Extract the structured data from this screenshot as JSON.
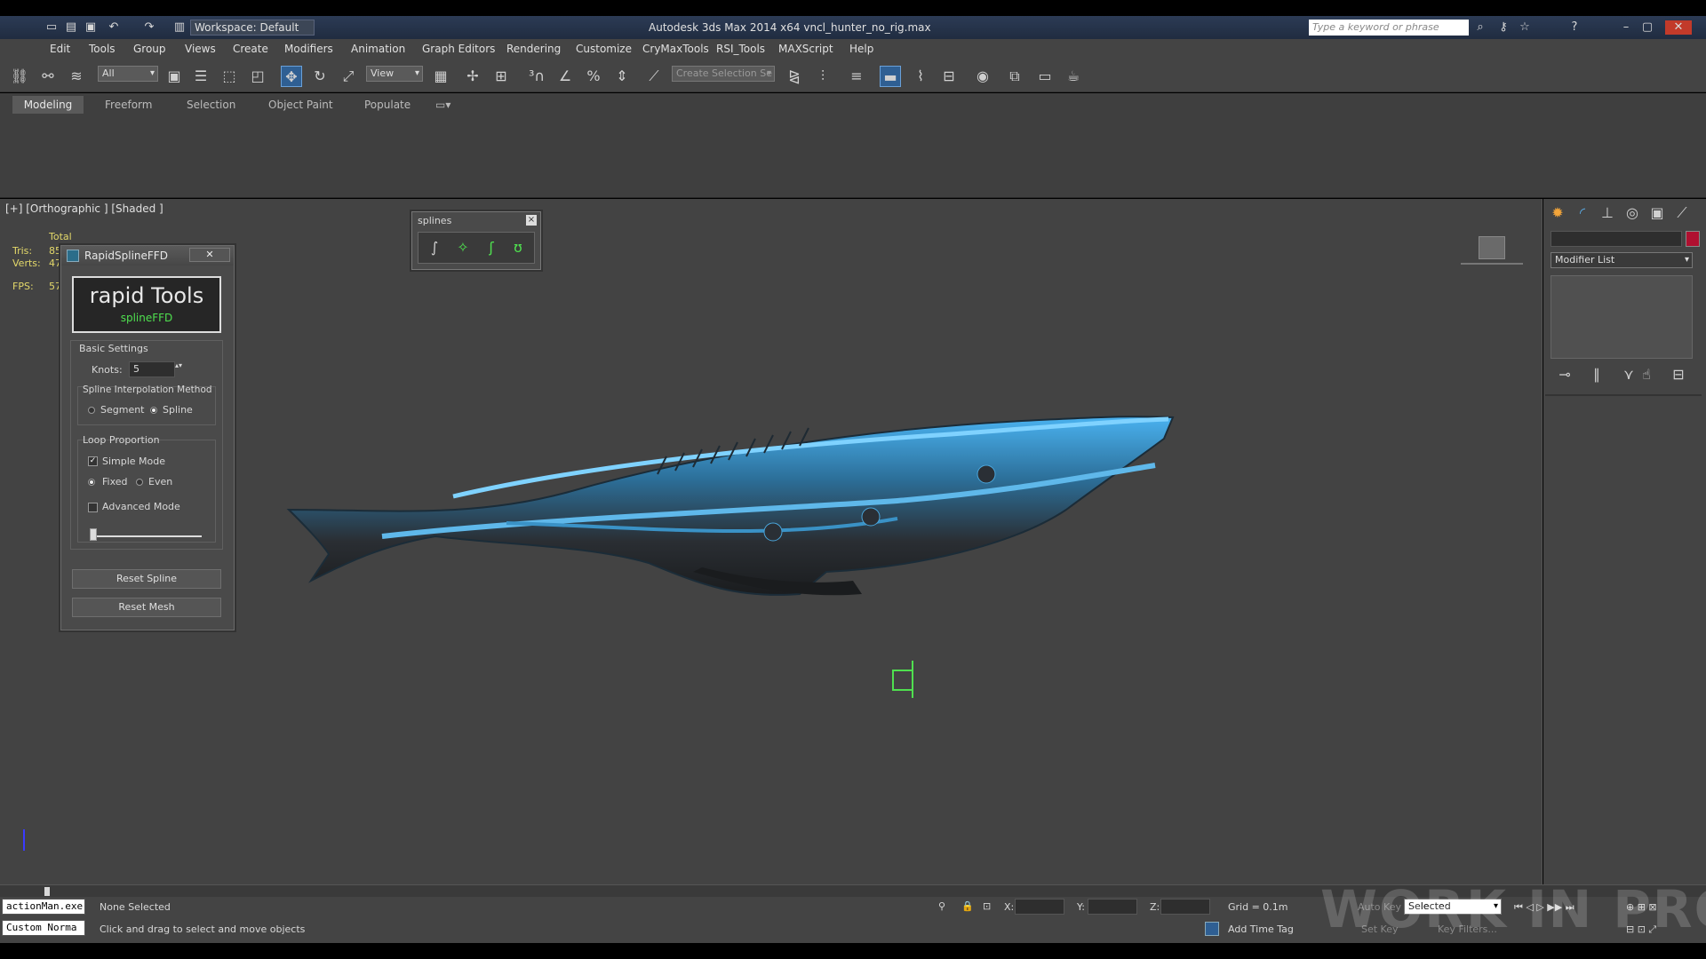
{
  "window": {
    "title": "Autodesk 3ds Max  2014 x64    vncl_hunter_no_rig.max",
    "workspace": "Workspace: Default",
    "search_placeholder": "Type a keyword or phrase"
  },
  "menu": [
    "Edit",
    "Tools",
    "Group",
    "Views",
    "Create",
    "Modifiers",
    "Animation",
    "Graph Editors",
    "Rendering",
    "Customize",
    "CryMaxTools",
    "RSI_Tools",
    "MAXScript",
    "Help"
  ],
  "toolbar": {
    "filter_value": "All",
    "coord_value": "View",
    "selection_set_placeholder": "Create Selection Se"
  },
  "ribbon_tabs": [
    "Modeling",
    "Freeform",
    "Selection",
    "Object Paint",
    "Populate"
  ],
  "viewport": {
    "label": "[+] [Orthographic ] [Shaded ]",
    "stats_header": "Total",
    "tris_label": "Tris:",
    "tris_value": "85",
    "verts_label": "Verts:",
    "verts_value": "47",
    "fps_label": "FPS:",
    "fps_value": "57"
  },
  "rapid_dialog": {
    "title": "RapidSplineFFD",
    "close": "✕",
    "brand": "rapid Tools",
    "brand_sub": "splineFFD",
    "basic_settings": "Basic Settings",
    "knots_label": "Knots:",
    "knots_value": "5",
    "interp_title": "Spline Interpolation Method",
    "opt_segment": "Segment",
    "opt_spline": "Spline",
    "loop_title": "Loop Proportion",
    "simple_mode": "Simple Mode",
    "opt_fixed": "Fixed",
    "opt_even": "Even",
    "advanced_mode": "Advanced Mode",
    "slider_value": 0.02,
    "reset_spline": "Reset Spline",
    "reset_mesh": "Reset Mesh"
  },
  "splines_toolbar": {
    "title": "splines",
    "close": "×"
  },
  "command_panel": {
    "modifier_list": "Modifier List",
    "color_swatch": "#b01030"
  },
  "status": {
    "script_listener_1": "actionMan.exe",
    "script_listener_2": "Custom Norma",
    "selection": "None Selected",
    "prompt": "Click and drag to select and move objects",
    "x_label": "X:",
    "y_label": "Y:",
    "z_label": "Z:",
    "grid": "Grid = 0.1m",
    "add_time_tag": "Add Time Tag",
    "auto_key": "Auto Key",
    "set_key": "Set Key",
    "selected": "Selected",
    "key_filters": "Key Filters..."
  },
  "watermark": "WORK IN PROGRESS",
  "colors": {
    "accent": "#2f5f93",
    "model_highlight": "#3aa0e8",
    "stats_text": "#e3d86a"
  }
}
